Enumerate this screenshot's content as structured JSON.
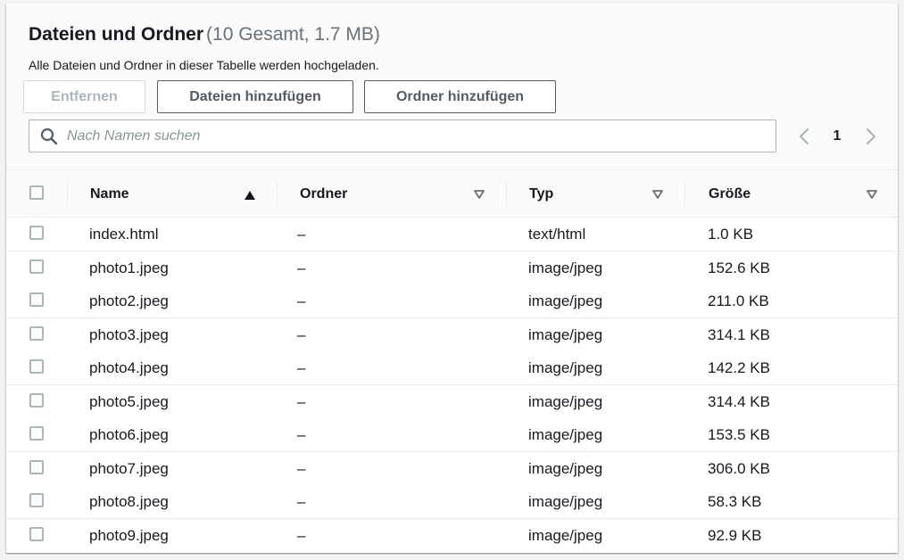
{
  "header": {
    "title": "Dateien und Ordner",
    "counter": "(10 Gesamt, 1.7 MB)",
    "description": "Alle Dateien und Ordner in dieser Tabelle werden hochgeladen."
  },
  "actions": {
    "remove_label": "Entfernen",
    "add_files_label": "Dateien hinzufügen",
    "add_folder_label": "Ordner hinzufügen"
  },
  "search": {
    "placeholder": "Nach Namen suchen",
    "value": ""
  },
  "pagination": {
    "current_page": "1",
    "prev_icon": "chevron-left-icon",
    "next_icon": "chevron-right-icon"
  },
  "table": {
    "columns": [
      {
        "label": "Name",
        "sort": "ascending"
      },
      {
        "label": "Ordner",
        "sort": "none"
      },
      {
        "label": "Typ",
        "sort": "none"
      },
      {
        "label": "Größe",
        "sort": "none"
      }
    ],
    "rows": [
      {
        "name": "index.html",
        "folder": "–",
        "type": "text/html",
        "size": "1.0 KB"
      },
      {
        "name": "photo1.jpeg",
        "folder": "–",
        "type": "image/jpeg",
        "size": "152.6 KB"
      },
      {
        "name": "photo2.jpeg",
        "folder": "–",
        "type": "image/jpeg",
        "size": "211.0 KB"
      },
      {
        "name": "photo3.jpeg",
        "folder": "–",
        "type": "image/jpeg",
        "size": "314.1 KB"
      },
      {
        "name": "photo4.jpeg",
        "folder": "–",
        "type": "image/jpeg",
        "size": "142.2 KB"
      },
      {
        "name": "photo5.jpeg",
        "folder": "–",
        "type": "image/jpeg",
        "size": "314.4 KB"
      },
      {
        "name": "photo6.jpeg",
        "folder": "–",
        "type": "image/jpeg",
        "size": "153.5 KB"
      },
      {
        "name": "photo7.jpeg",
        "folder": "–",
        "type": "image/jpeg",
        "size": "306.0 KB"
      },
      {
        "name": "photo8.jpeg",
        "folder": "–",
        "type": "image/jpeg",
        "size": "58.3 KB"
      },
      {
        "name": "photo9.jpeg",
        "folder": "–",
        "type": "image/jpeg",
        "size": "92.9 KB"
      }
    ]
  },
  "colors": {
    "text": "#16191f",
    "muted": "#687078",
    "button_border": "#545b64",
    "disabled": "#aab7b8",
    "header_bg": "#fafafa",
    "divider": "#eaeded"
  }
}
